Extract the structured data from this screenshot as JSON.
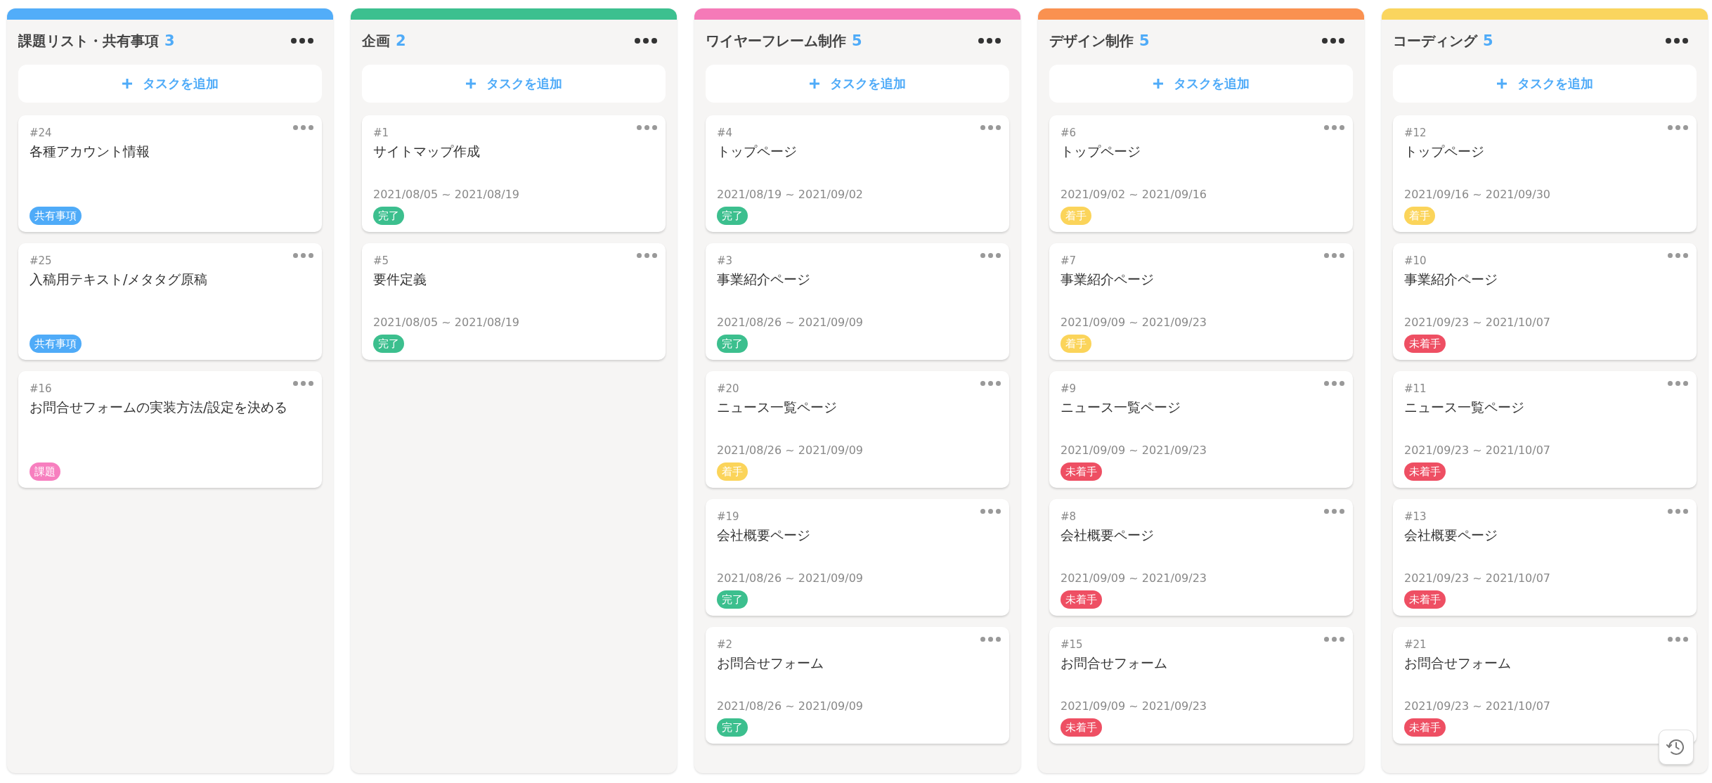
{
  "columns": [
    {
      "title": "課題リスト・共有事項",
      "count": "3",
      "color": "#52adf9",
      "add_label": "タスクを追加",
      "cards": [
        {
          "id": "#24",
          "title": "各種アカウント情報",
          "tag": "共有事項",
          "color": "#4fabf8"
        },
        {
          "id": "#25",
          "title": "入稿用テキスト/メタタグ原稿",
          "tag": "共有事項",
          "color": "#4fabf8"
        },
        {
          "id": "#16",
          "title": "お問合せフォームの実装方法/設定を決める",
          "tag": "課題",
          "color": "#f77fbf"
        }
      ]
    },
    {
      "title": "企画",
      "count": "2",
      "color": "#3cc08f",
      "add_label": "タスクを追加",
      "cards": [
        {
          "id": "#1",
          "title": "サイトマップ作成",
          "dates": "2021/08/05 ~ 2021/08/19",
          "tag": "完了",
          "color": "#3cbf8e"
        },
        {
          "id": "#5",
          "title": "要件定義",
          "dates": "2021/08/05 ~ 2021/08/19",
          "tag": "完了",
          "color": "#3cbf8e"
        }
      ]
    },
    {
      "title": "ワイヤーフレーム制作",
      "count": "5",
      "color": "#f57ab8",
      "add_label": "タスクを追加",
      "cards": [
        {
          "id": "#4",
          "title": "トップページ",
          "dates": "2021/08/19 ~ 2021/09/02",
          "tag": "完了",
          "color": "#3cbf8e"
        },
        {
          "id": "#3",
          "title": "事業紹介ページ",
          "dates": "2021/08/26 ~ 2021/09/09",
          "tag": "完了",
          "color": "#3cbf8e"
        },
        {
          "id": "#20",
          "title": "ニュース一覧ページ",
          "dates": "2021/08/26 ~ 2021/09/09",
          "tag": "着手",
          "color": "#fbd45a"
        },
        {
          "id": "#19",
          "title": "会社概要ページ",
          "dates": "2021/08/26 ~ 2021/09/09",
          "tag": "完了",
          "color": "#3cbf8e"
        },
        {
          "id": "#2",
          "title": "お問合せフォーム",
          "dates": "2021/08/26 ~ 2021/09/09",
          "tag": "完了",
          "color": "#3cbf8e"
        }
      ]
    },
    {
      "title": "デザイン制作",
      "count": "5",
      "color": "#fa9150",
      "add_label": "タスクを追加",
      "cards": [
        {
          "id": "#6",
          "title": "トップページ",
          "dates": "2021/09/02 ~ 2021/09/16",
          "tag": "着手",
          "color": "#fbd45a"
        },
        {
          "id": "#7",
          "title": "事業紹介ページ",
          "dates": "2021/09/09 ~ 2021/09/23",
          "tag": "着手",
          "color": "#fbd45a"
        },
        {
          "id": "#9",
          "title": "ニュース一覧ページ",
          "dates": "2021/09/09 ~ 2021/09/23",
          "tag": "未着手",
          "color": "#ee4f63"
        },
        {
          "id": "#8",
          "title": "会社概要ページ",
          "dates": "2021/09/09 ~ 2021/09/23",
          "tag": "未着手",
          "color": "#ee4f63"
        },
        {
          "id": "#15",
          "title": "お問合せフォーム",
          "dates": "2021/09/09 ~ 2021/09/23",
          "tag": "未着手",
          "color": "#ee4f63"
        }
      ]
    },
    {
      "title": "コーディング",
      "count": "5",
      "color": "#fad55e",
      "add_label": "タスクを追加",
      "cards": [
        {
          "id": "#12",
          "title": "トップページ",
          "dates": "2021/09/16 ~ 2021/09/30",
          "tag": "着手",
          "color": "#fbd45a"
        },
        {
          "id": "#10",
          "title": "事業紹介ページ",
          "dates": "2021/09/23 ~ 2021/10/07",
          "tag": "未着手",
          "color": "#ee4f63"
        },
        {
          "id": "#11",
          "title": "ニュース一覧ページ",
          "dates": "2021/09/23 ~ 2021/10/07",
          "tag": "未着手",
          "color": "#ee4f63"
        },
        {
          "id": "#13",
          "title": "会社概要ページ",
          "dates": "2021/09/23 ~ 2021/10/07",
          "tag": "未着手",
          "color": "#ee4f63"
        },
        {
          "id": "#21",
          "title": "お問合せフォーム",
          "dates": "2021/09/23 ~ 2021/10/07",
          "tag": "未着手",
          "color": "#ee4f63"
        }
      ]
    }
  ]
}
